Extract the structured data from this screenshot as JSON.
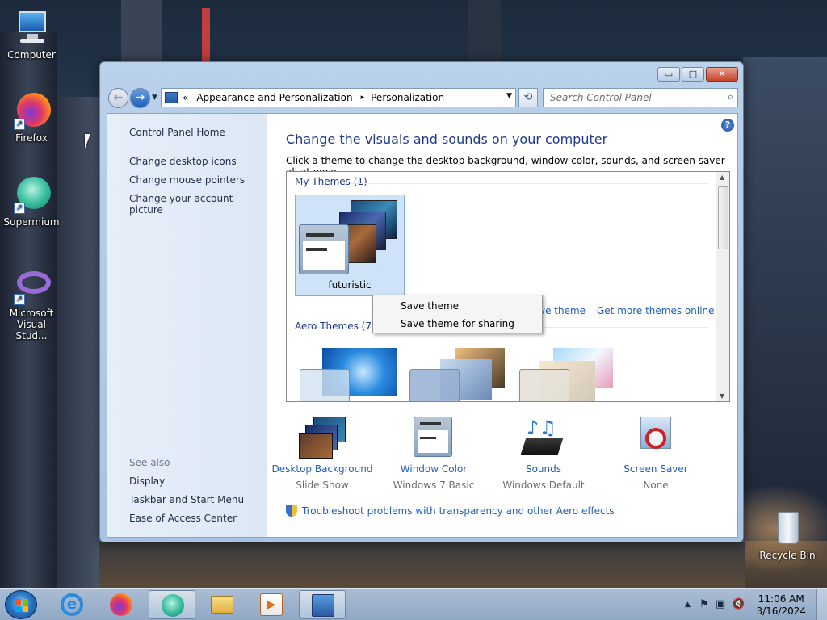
{
  "desktop": {
    "icons": [
      {
        "label": "Computer"
      },
      {
        "label": "Firefox"
      },
      {
        "label": "Supermium"
      },
      {
        "label": "Microsoft Visual Stud..."
      },
      {
        "label": "Recycle Bin"
      }
    ]
  },
  "window": {
    "controls": {
      "minimize": "▭",
      "maximize": "□",
      "close": "✕"
    },
    "address": {
      "prefix": "«",
      "segments": [
        "Appearance and Personalization",
        "Personalization"
      ],
      "separator": "▸"
    },
    "search_placeholder": "Search Control Panel",
    "left_pane": {
      "home": "Control Panel Home",
      "links": [
        "Change desktop icons",
        "Change mouse pointers",
        "Change your account picture"
      ],
      "see_also_label": "See also",
      "see_also": [
        "Display",
        "Taskbar and Start Menu",
        "Ease of Access Center"
      ]
    },
    "main": {
      "title": "Change the visuals and sounds on your computer",
      "subtitle": "Click a theme to change the desktop background, window color, sounds, and screen saver all at once.",
      "my_themes_label": "My Themes (1)",
      "my_theme_name": "futuristic",
      "save_theme_link": "ve theme",
      "get_more_link": "Get more themes online",
      "aero_themes_label": "Aero Themes (7)"
    },
    "context_menu": [
      "Save theme",
      "Save theme for sharing"
    ],
    "bottom": [
      {
        "label": "Desktop Background",
        "value": "Slide Show"
      },
      {
        "label": "Window Color",
        "value": "Windows 7 Basic"
      },
      {
        "label": "Sounds",
        "value": "Windows Default"
      },
      {
        "label": "Screen Saver",
        "value": "None"
      }
    ],
    "troubleshoot": "Troubleshoot problems with transparency and other Aero effects"
  },
  "taskbar": {
    "time": "11:06 AM",
    "date": "3/16/2024"
  },
  "colors": {
    "link": "#1e5eb8",
    "title": "#1e3a8e",
    "accent": "#cfe3f8"
  }
}
